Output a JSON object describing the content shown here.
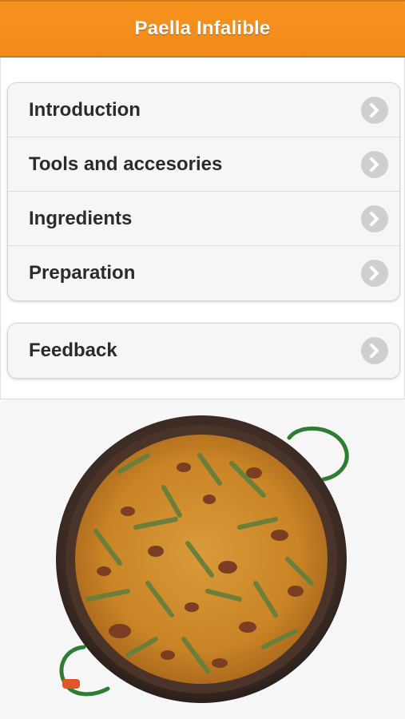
{
  "header": {
    "title": "Paella Infalible"
  },
  "menu": {
    "items": [
      {
        "label": "Introduction",
        "icon": "chevron-right-icon"
      },
      {
        "label": "Tools and accesories",
        "icon": "chevron-right-icon"
      },
      {
        "label": "Ingredients",
        "icon": "chevron-right-icon"
      },
      {
        "label": "Preparation",
        "icon": "chevron-right-icon"
      }
    ],
    "feedback": {
      "label": "Feedback",
      "icon": "chevron-right-icon"
    }
  },
  "image": {
    "subject": "paella-pan-image"
  },
  "colors": {
    "header": "#f8931f",
    "text": "#2b2b2b",
    "chevron": "#cfcfcf"
  }
}
